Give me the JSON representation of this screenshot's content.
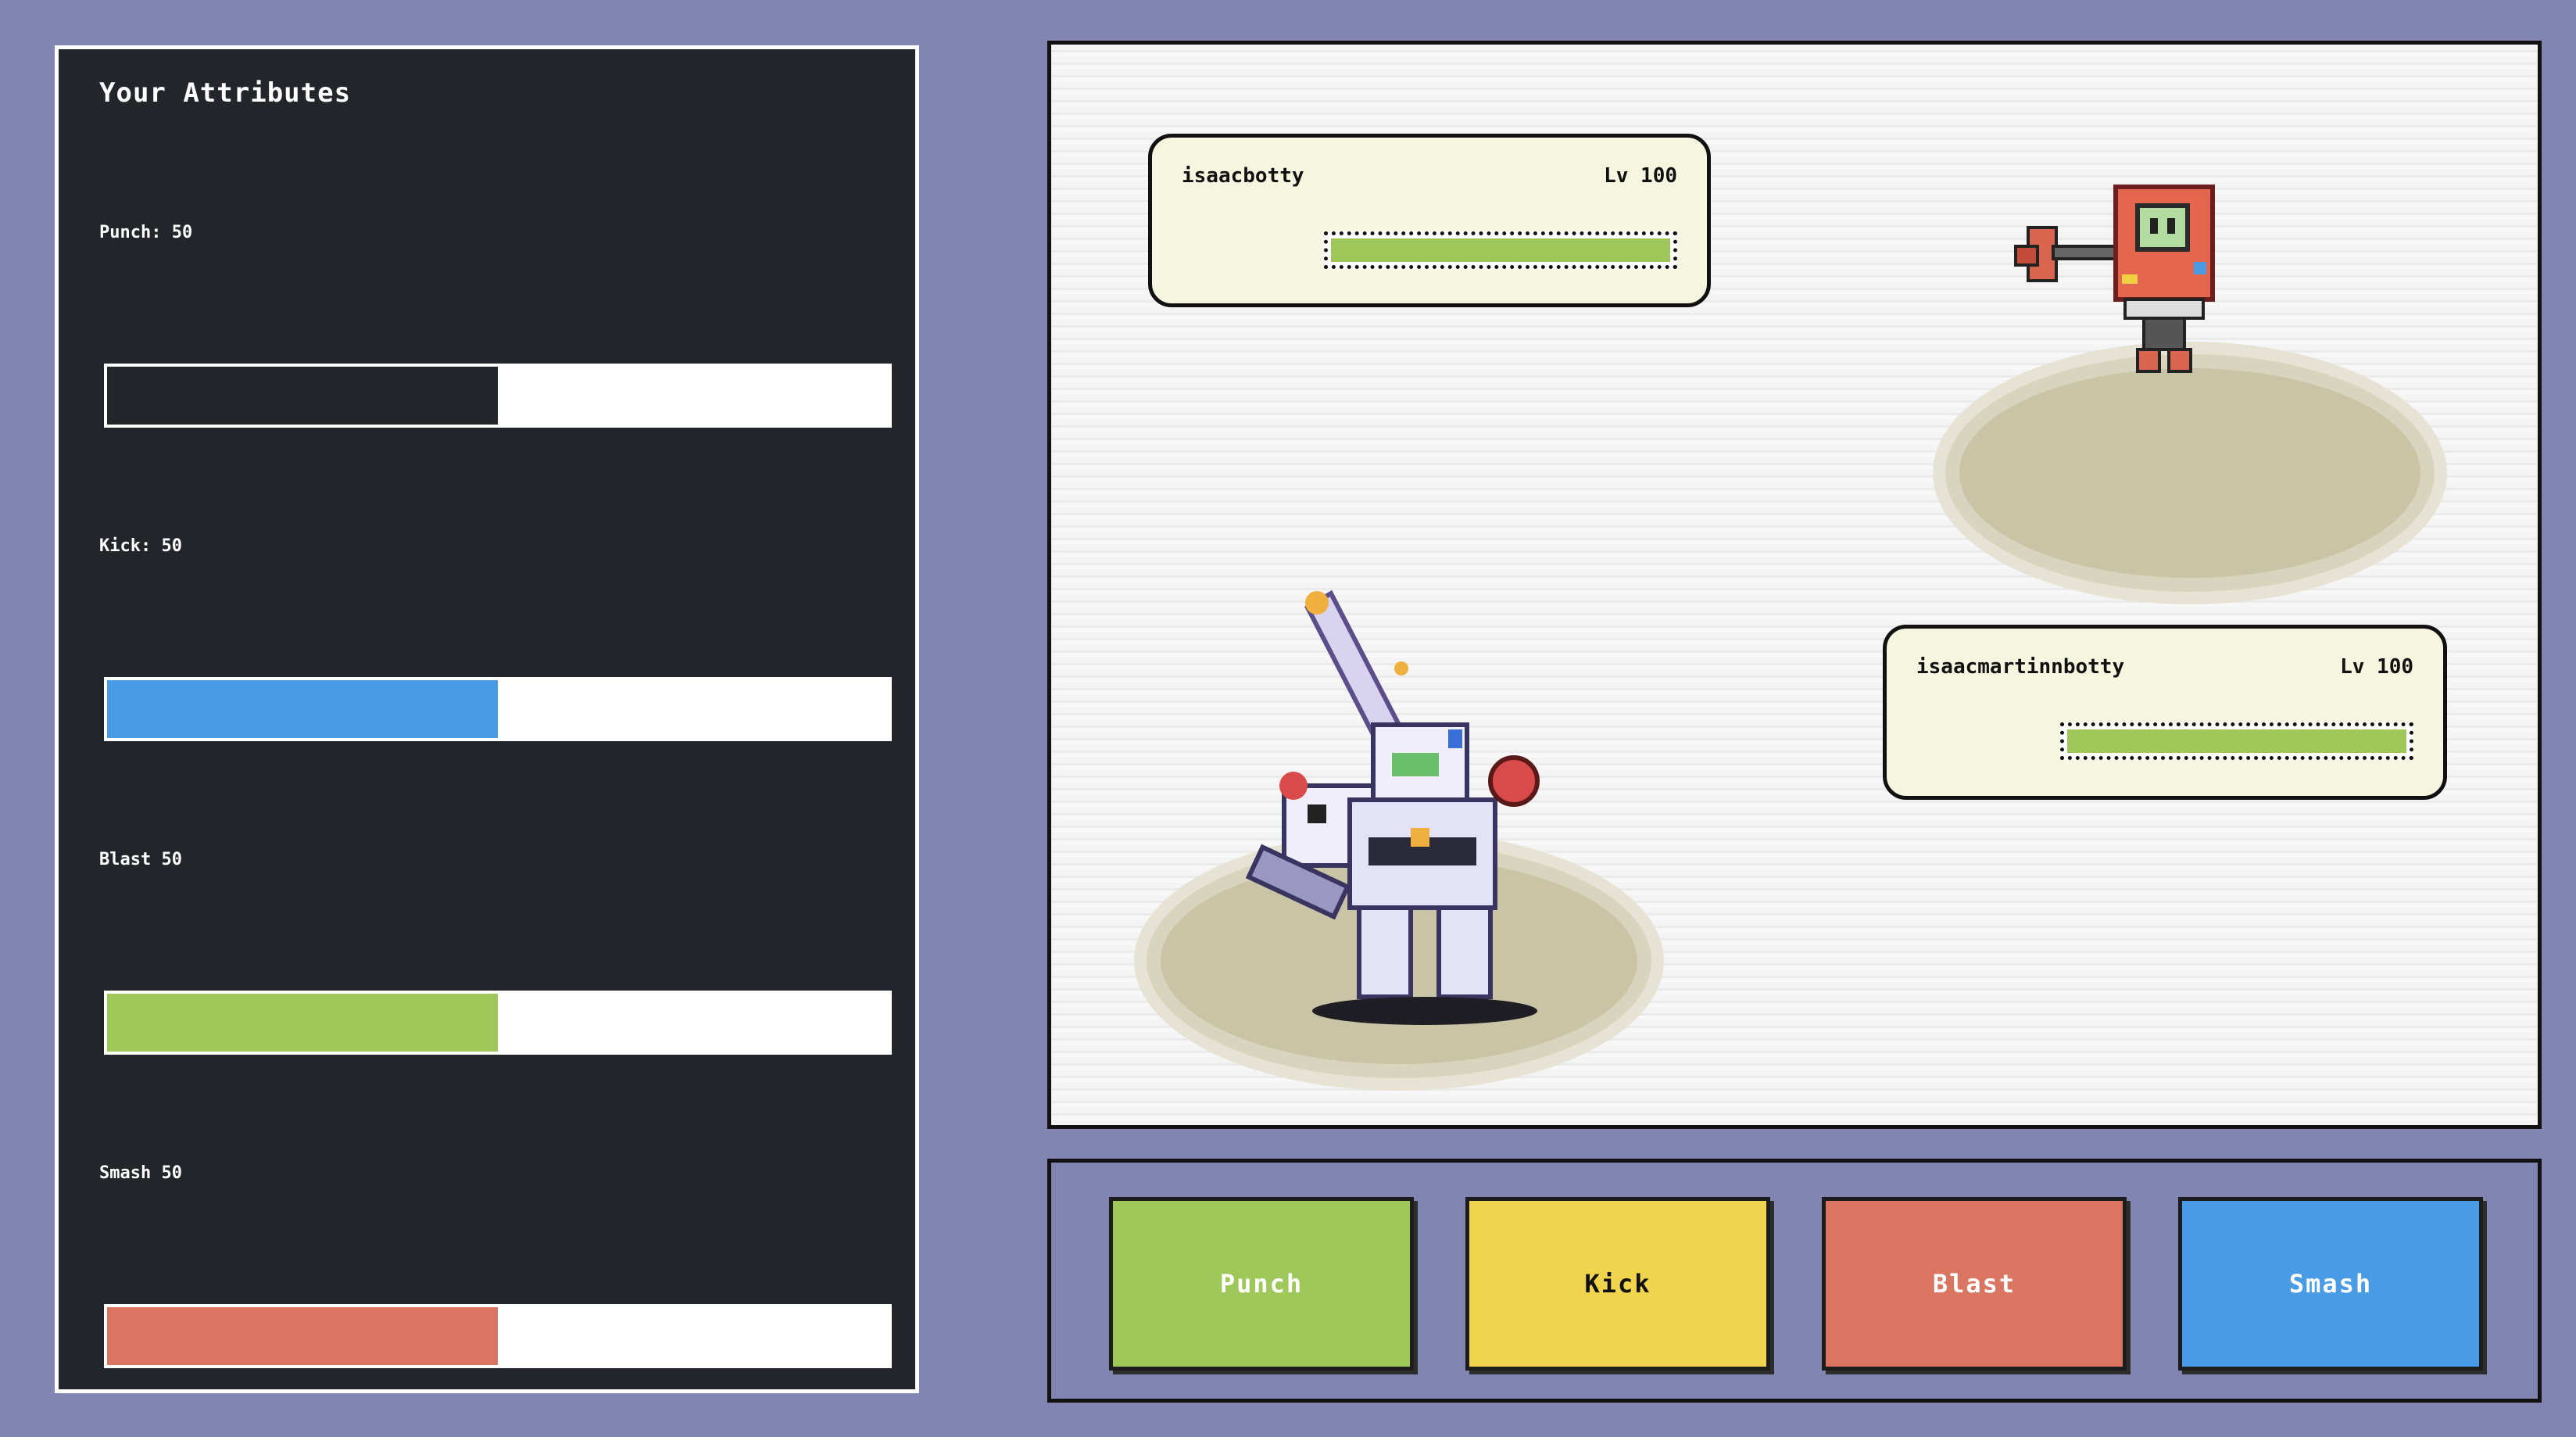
{
  "attributes_panel": {
    "title": "Your Attributes",
    "items": [
      {
        "label": "Punch: 50",
        "value": 50,
        "max": 100,
        "color": "#22252a"
      },
      {
        "label": "Kick: 50",
        "value": 50,
        "max": 100,
        "color": "#4a9be5"
      },
      {
        "label": "Blast 50",
        "value": 50,
        "max": 100,
        "color": "#9ec95a"
      },
      {
        "label": "Smash 50",
        "value": 50,
        "max": 100,
        "color": "#d97560"
      }
    ]
  },
  "battle": {
    "opponent": {
      "name": "isaacbotty",
      "level": "Lv 100",
      "hp": 1.0,
      "hp_color": "#9ec95a"
    },
    "player": {
      "name": "isaacmartinnbotty",
      "level": "Lv 100",
      "hp": 1.0,
      "hp_color": "#9ec95a"
    }
  },
  "moves": [
    {
      "label": "Punch",
      "color": "#9ec95a",
      "text_color": "#ffffff"
    },
    {
      "label": "Kick",
      "color": "#f1d44e",
      "text_color": "#111111"
    },
    {
      "label": "Blast",
      "color": "#d97560",
      "text_color": "#ffffff"
    },
    {
      "label": "Smash",
      "color": "#4a9be5",
      "text_color": "#ffffff"
    }
  ],
  "colors": {
    "background": "#8285b2",
    "panel": "#22252a",
    "status_box": "#f5f5e0"
  }
}
